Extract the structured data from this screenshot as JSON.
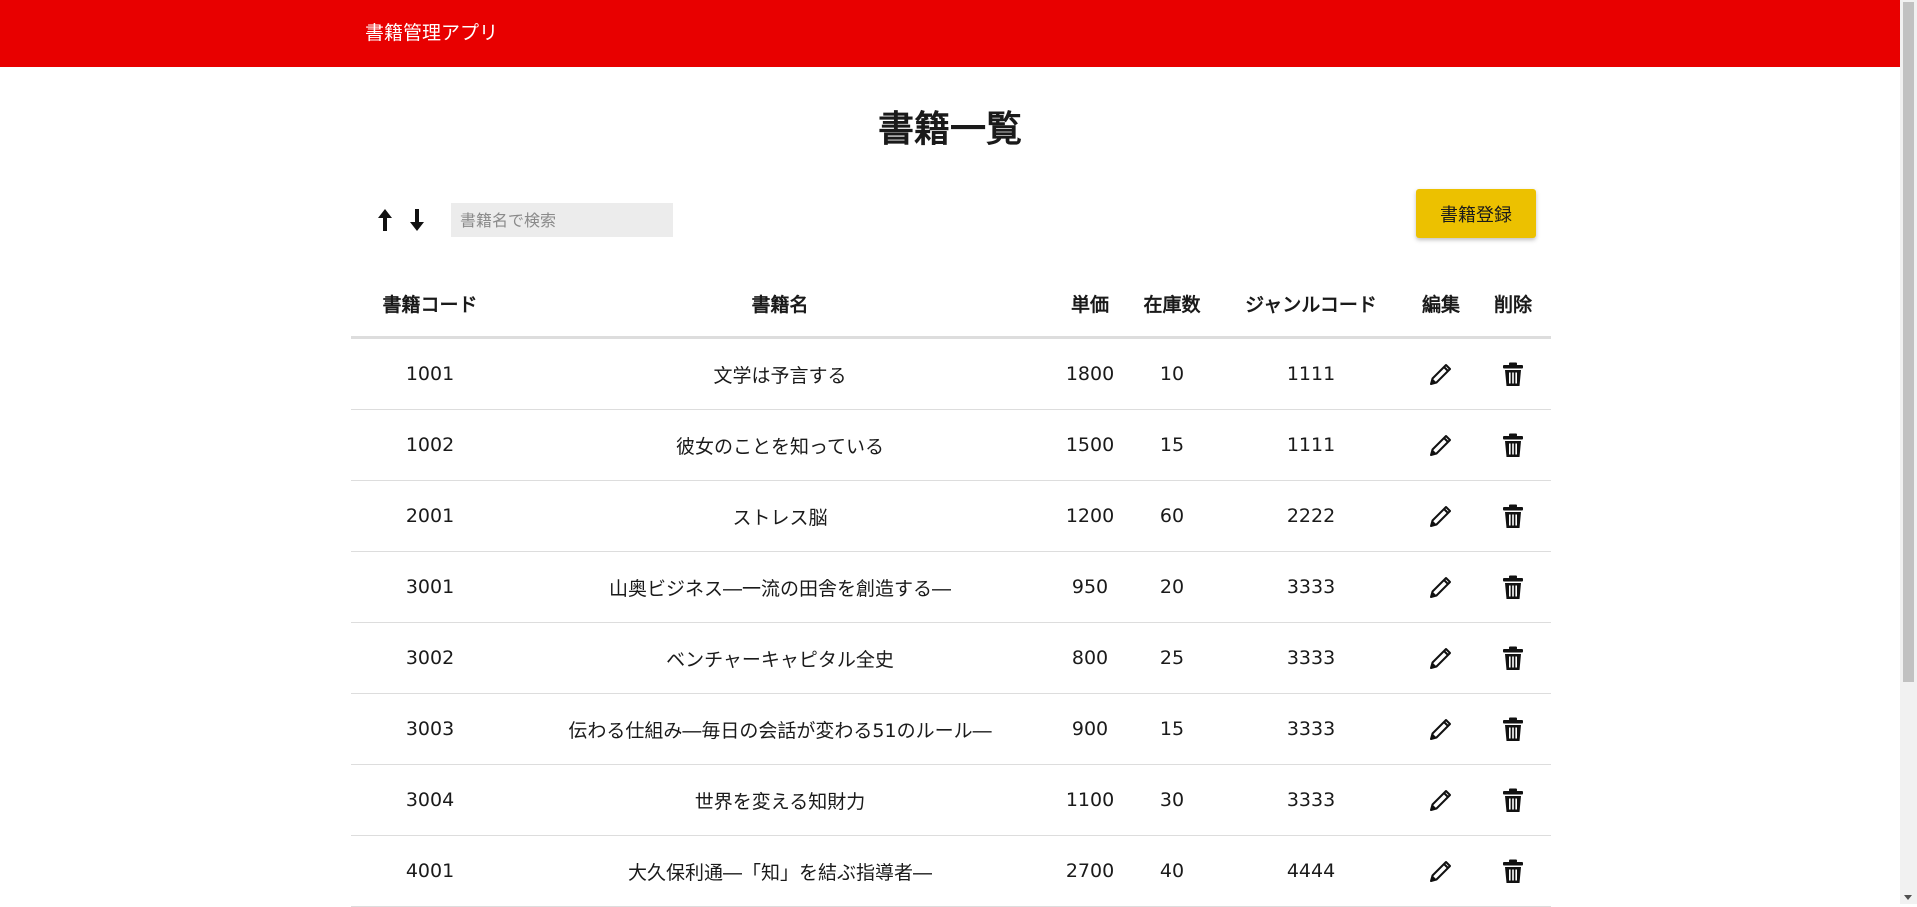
{
  "header": {
    "app_title": "書籍管理アプリ",
    "background_color": "#e80000"
  },
  "main": {
    "page_title": "書籍一覧",
    "sort": {
      "asc_icon": "arrow-up-icon",
      "desc_icon": "arrow-down-icon"
    },
    "search": {
      "placeholder": "書籍名で検索",
      "value": ""
    },
    "register_button": {
      "label": "書籍登録",
      "color": "#ecc100"
    }
  },
  "table": {
    "columns": [
      "書籍コード",
      "書籍名",
      "単価",
      "在庫数",
      "ジャンルコード",
      "編集",
      "削除"
    ],
    "edit_icon": "pencil-icon",
    "delete_icon": "trash-icon",
    "rows": [
      {
        "code": "1001",
        "name": "文学は予言する",
        "price": "1800",
        "stock": "10",
        "genre": "1111"
      },
      {
        "code": "1002",
        "name": "彼女のことを知っている",
        "price": "1500",
        "stock": "15",
        "genre": "1111"
      },
      {
        "code": "2001",
        "name": "ストレス脳",
        "price": "1200",
        "stock": "60",
        "genre": "2222"
      },
      {
        "code": "3001",
        "name": "山奥ビジネス―一流の田舎を創造する―",
        "price": "950",
        "stock": "20",
        "genre": "3333"
      },
      {
        "code": "3002",
        "name": "ベンチャーキャピタル全史",
        "price": "800",
        "stock": "25",
        "genre": "3333"
      },
      {
        "code": "3003",
        "name": "伝わる仕組み―毎日の会話が変わる51のルール―",
        "price": "900",
        "stock": "15",
        "genre": "3333"
      },
      {
        "code": "3004",
        "name": "世界を変える知財力",
        "price": "1100",
        "stock": "30",
        "genre": "3333"
      },
      {
        "code": "4001",
        "name": "大久保利通―「知」を結ぶ指導者―",
        "price": "2700",
        "stock": "40",
        "genre": "4444"
      }
    ]
  }
}
